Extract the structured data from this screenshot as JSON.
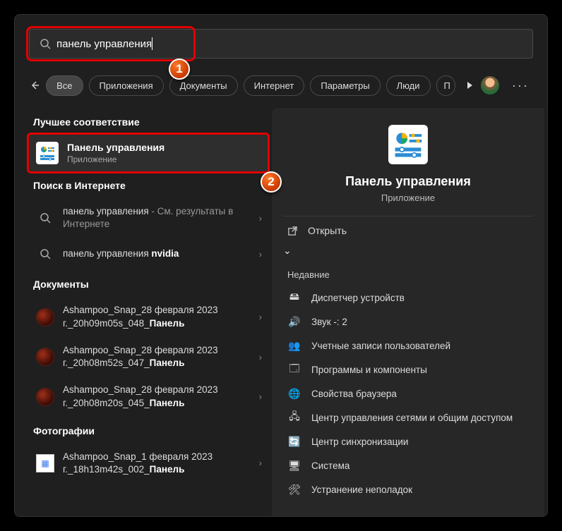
{
  "search": {
    "query": "панель управления"
  },
  "filters": {
    "back": "←",
    "tabs": [
      "Все",
      "Приложения",
      "Документы",
      "Интернет",
      "Параметры",
      "Люди",
      "П"
    ]
  },
  "left_panel": {
    "best_match_header": "Лучшее соответствие",
    "best_match": {
      "title": "Панель управления",
      "subtitle": "Приложение"
    },
    "web_header": "Поиск в Интернете",
    "web": [
      {
        "prefix": "панель управления",
        "suffix": " - См. результаты в Интернете"
      },
      {
        "prefix": "панель управления ",
        "bold": "nvidia"
      }
    ],
    "docs_header": "Документы",
    "docs": [
      {
        "l1": "Ashampoo_Snap_28 февраля 2023",
        "l2a": "г._20h09m05s_048_",
        "l2b": "Панель"
      },
      {
        "l1": "Ashampoo_Snap_28 февраля 2023",
        "l2a": "г._20h08m52s_047_",
        "l2b": "Панель"
      },
      {
        "l1": "Ashampoo_Snap_28 февраля 2023",
        "l2a": "г._20h08m20s_045_",
        "l2b": "Панель"
      }
    ],
    "photos_header": "Фотографии",
    "photos": [
      {
        "l1": "Ashampoo_Snap_1 февраля 2023",
        "l2a": "г._18h13m42s_002_",
        "l2b": "Панель"
      }
    ]
  },
  "right_panel": {
    "title": "Панель управления",
    "subtitle": "Приложение",
    "open": "Открыть",
    "recent_header": "Недавние",
    "recent": [
      "Диспетчер устройств",
      "Звук -: 2",
      "Учетные записи пользователей",
      "Программы и компоненты",
      "Свойства браузера",
      "Центр управления сетями и общим доступом",
      "Центр синхронизации",
      "Система",
      "Устранение неполадок"
    ]
  },
  "badges": {
    "one": "1",
    "two": "2"
  }
}
